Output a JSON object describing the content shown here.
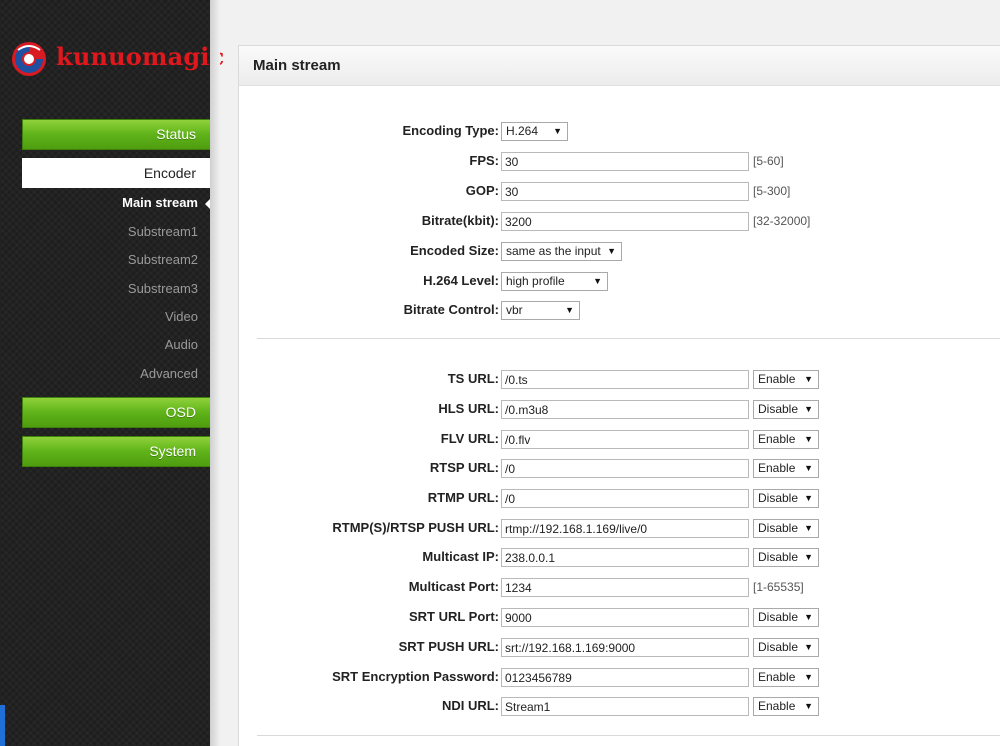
{
  "brand": {
    "name": "kunuomagic",
    "color": "#e0181e"
  },
  "sidebar": {
    "status": "Status",
    "encoder": "Encoder",
    "sub_items": [
      "Main stream",
      "Substream1",
      "Substream2",
      "Substream3",
      "Video",
      "Audio",
      "Advanced"
    ],
    "active_sub": "Main stream",
    "osd": "OSD",
    "system": "System"
  },
  "panel": {
    "title": "Main stream",
    "encoding": {
      "encoding_type": {
        "label": "Encoding Type:",
        "value": "H.264"
      },
      "fps": {
        "label": "FPS:",
        "value": "30",
        "range": "[5-60]"
      },
      "gop": {
        "label": "GOP:",
        "value": "30",
        "range": "[5-300]"
      },
      "bitrate": {
        "label": "Bitrate(kbit):",
        "value": "3200",
        "range": "[32-32000]"
      },
      "encoded_size": {
        "label": "Encoded Size:",
        "value": "same as the input"
      },
      "h264_level": {
        "label": "H.264 Level:",
        "value": "high profile"
      },
      "bitrate_control": {
        "label": "Bitrate Control:",
        "value": "vbr"
      }
    },
    "urls": {
      "ts": {
        "label": "TS URL:",
        "value": "/0.ts",
        "state": "Enable"
      },
      "hls": {
        "label": "HLS URL:",
        "value": "/0.m3u8",
        "state": "Disable"
      },
      "flv": {
        "label": "FLV URL:",
        "value": "/0.flv",
        "state": "Enable"
      },
      "rtsp": {
        "label": "RTSP URL:",
        "value": "/0",
        "state": "Enable"
      },
      "rtmp": {
        "label": "RTMP URL:",
        "value": "/0",
        "state": "Disable"
      },
      "push": {
        "label": "RTMP(S)/RTSP PUSH URL:",
        "value": "rtmp://192.168.1.169/live/0",
        "state": "Disable"
      },
      "multicast_ip": {
        "label": "Multicast IP:",
        "value": "238.0.0.1",
        "state": "Disable"
      },
      "multicast_port": {
        "label": "Multicast Port:",
        "value": "1234",
        "range": "[1-65535]"
      },
      "srt_port": {
        "label": "SRT URL Port:",
        "value": "9000",
        "state": "Disable"
      },
      "srt_push": {
        "label": "SRT PUSH URL:",
        "value": "srt://192.168.1.169:9000",
        "state": "Disable"
      },
      "srt_password": {
        "label": "SRT Encryption Password:",
        "value": "0123456789",
        "state": "Enable"
      },
      "ndi": {
        "label": "NDI URL:",
        "value": "Stream1",
        "state": "Enable"
      }
    }
  },
  "icons": {
    "dropdown": "caret-down-icon",
    "logo": "logo-swirl-icon"
  },
  "colors": {
    "green_button": "#5fb319",
    "sidebar_bg": "#1e1e1e"
  }
}
